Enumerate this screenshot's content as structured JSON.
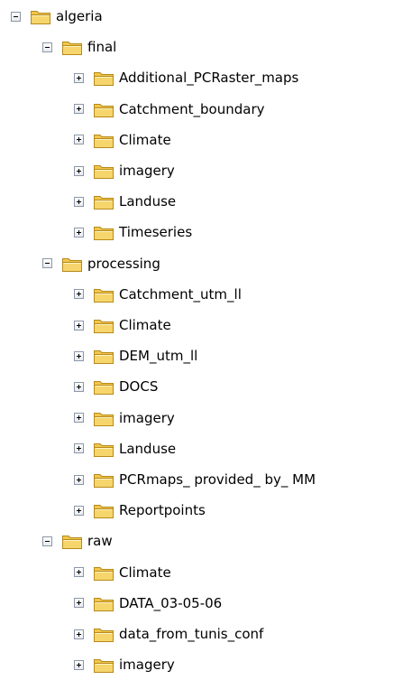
{
  "tree": {
    "root": {
      "label": "algeria",
      "expander": "minus",
      "icon": "folder-icon",
      "children": [
        {
          "label": "final",
          "expander": "minus",
          "icon": "folder-icon",
          "children": [
            {
              "label": "Additional_PCRaster_maps",
              "expander": "plus",
              "icon": "folder-icon"
            },
            {
              "label": "Catchment_boundary",
              "expander": "plus",
              "icon": "folder-icon"
            },
            {
              "label": "Climate",
              "expander": "plus",
              "icon": "folder-icon"
            },
            {
              "label": "imagery",
              "expander": "plus",
              "icon": "folder-icon"
            },
            {
              "label": "Landuse",
              "expander": "plus",
              "icon": "folder-icon"
            },
            {
              "label": "Timeseries",
              "expander": "plus",
              "icon": "folder-icon"
            }
          ]
        },
        {
          "label": "processing",
          "expander": "minus",
          "icon": "folder-icon",
          "children": [
            {
              "label": "Catchment_utm_ll",
              "expander": "plus",
              "icon": "folder-icon"
            },
            {
              "label": "Climate",
              "expander": "plus",
              "icon": "folder-icon"
            },
            {
              "label": "DEM_utm_ll",
              "expander": "plus",
              "icon": "folder-icon"
            },
            {
              "label": "DOCS",
              "expander": "plus",
              "icon": "folder-icon"
            },
            {
              "label": "imagery",
              "expander": "plus",
              "icon": "folder-icon"
            },
            {
              "label": "Landuse",
              "expander": "plus",
              "icon": "folder-icon"
            },
            {
              "label": "PCRmaps_ provided_ by_ MM",
              "expander": "plus",
              "icon": "folder-icon"
            },
            {
              "label": "Reportpoints",
              "expander": "plus",
              "icon": "folder-icon"
            }
          ]
        },
        {
          "label": "raw",
          "expander": "minus",
          "icon": "folder-icon",
          "children": [
            {
              "label": "Climate",
              "expander": "plus",
              "icon": "folder-icon"
            },
            {
              "label": "DATA_03-05-06",
              "expander": "plus",
              "icon": "folder-icon"
            },
            {
              "label": "data_from_tunis_conf",
              "expander": "plus",
              "icon": "folder-icon"
            },
            {
              "label": "imagery",
              "expander": "plus",
              "icon": "folder-icon"
            }
          ]
        }
      ]
    }
  },
  "colors": {
    "folder_fill": "#f6d66c",
    "folder_tab": "#f2c64a",
    "folder_outline": "#b68a1c",
    "expander_border": "#8c97a6",
    "text": "#000000"
  }
}
